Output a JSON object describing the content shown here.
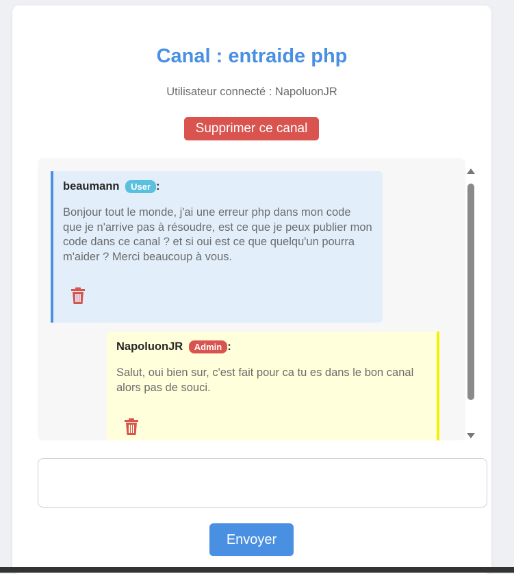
{
  "channel": {
    "title": "Canal : entraide php",
    "connected_user": "Utilisateur connecté : NapoluonJR",
    "delete_label": "Supprimer ce canal"
  },
  "messages": [
    {
      "author": "beaumann",
      "role": "User",
      "separator": ":",
      "text": "Bonjour tout le monde, j'ai une erreur php dans mon code que je n'arrive pas à résoudre, est ce que je peux publier mon code dans ce canal ? et si oui est ce que quelqu'un pourra m'aider ? Merci beaucoup à vous."
    },
    {
      "author": "NapoluonJR",
      "role": "Admin",
      "separator": ":",
      "text": "Salut, oui bien sur, c'est fait pour ca tu es dans le bon canal alors pas de souci."
    }
  ],
  "composer": {
    "value": "",
    "send_label": "Envoyer"
  },
  "icons": {
    "delete": "trash-icon",
    "scroll_up": "scroll-up-arrow-icon",
    "scroll_down": "scroll-down-arrow-icon"
  },
  "colors": {
    "accent": "#4a90e2",
    "danger": "#d9534f",
    "user_badge": "#5bc0de",
    "user_message_bg": "#e2effb",
    "admin_message_bg": "#ffffdc",
    "admin_message_border": "#f3f000"
  }
}
